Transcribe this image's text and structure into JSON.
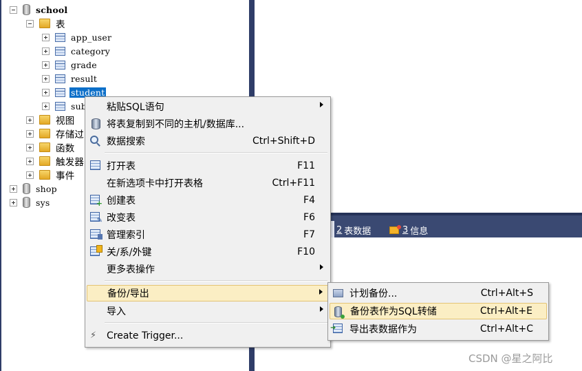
{
  "tree": {
    "items": [
      {
        "label": "school",
        "toggle": "minus",
        "icon": "database-icon",
        "style": "bold"
      },
      {
        "label": "表",
        "toggle": "minus",
        "icon": "folder-icon",
        "style": "cjk"
      },
      {
        "label": "app_user",
        "toggle": "plus",
        "icon": "table-icon",
        "style": "plain"
      },
      {
        "label": "category",
        "toggle": "plus",
        "icon": "table-icon",
        "style": "plain"
      },
      {
        "label": "grade",
        "toggle": "plus",
        "icon": "table-icon",
        "style": "plain"
      },
      {
        "label": "result",
        "toggle": "plus",
        "icon": "table-icon",
        "style": "plain"
      },
      {
        "label": "student",
        "toggle": "plus",
        "icon": "table-icon",
        "style": "selected"
      },
      {
        "label": "sub",
        "toggle": "plus",
        "icon": "table-icon",
        "style": "plain"
      },
      {
        "label": "视图",
        "toggle": "plus",
        "icon": "folder-icon",
        "style": "cjk"
      },
      {
        "label": "存储过",
        "toggle": "plus",
        "icon": "folder-icon",
        "style": "cjk"
      },
      {
        "label": "函数",
        "toggle": "plus",
        "icon": "folder-icon",
        "style": "cjk"
      },
      {
        "label": "触发器",
        "toggle": "plus",
        "icon": "folder-icon",
        "style": "cjk"
      },
      {
        "label": "事件",
        "toggle": "plus",
        "icon": "folder-icon",
        "style": "cjk"
      },
      {
        "label": "shop",
        "toggle": "plus",
        "icon": "database-icon",
        "style": "plain"
      },
      {
        "label": "sys",
        "toggle": "plus",
        "icon": "database-icon",
        "style": "plain"
      }
    ]
  },
  "result_tabs": [
    {
      "num": "2",
      "label": "表数据"
    },
    {
      "num": "3",
      "label": "信息"
    }
  ],
  "context_menu": {
    "items": [
      {
        "label": "粘贴SQL语句",
        "shortcut": "",
        "submenu": true,
        "icon": ""
      },
      {
        "label": "将表复制到不同的主机/数据库...",
        "shortcut": "",
        "submenu": false,
        "icon": "copy-database-icon"
      },
      {
        "label": "数据搜索",
        "shortcut": "Ctrl+Shift+D",
        "submenu": false,
        "icon": "search-icon"
      },
      {
        "label": "打开表",
        "shortcut": "F11",
        "submenu": false,
        "icon": "table-icon"
      },
      {
        "label": "在新选项卡中打开表格",
        "shortcut": "Ctrl+F11",
        "submenu": false,
        "icon": ""
      },
      {
        "label": "创建表",
        "shortcut": "F4",
        "submenu": false,
        "icon": "create-table-icon"
      },
      {
        "label": "改变表",
        "shortcut": "F6",
        "submenu": false,
        "icon": "alter-table-icon"
      },
      {
        "label": "管理索引",
        "shortcut": "F7",
        "submenu": false,
        "icon": "index-icon"
      },
      {
        "label": "关/系/外键",
        "shortcut": "F10",
        "submenu": false,
        "icon": "foreign-key-icon"
      },
      {
        "label": "更多表操作",
        "shortcut": "",
        "submenu": true,
        "icon": ""
      },
      {
        "label": "备份/导出",
        "shortcut": "",
        "submenu": true,
        "icon": ""
      },
      {
        "label": "导入",
        "shortcut": "",
        "submenu": true,
        "icon": ""
      },
      {
        "label": "Create Trigger...",
        "shortcut": "",
        "submenu": false,
        "icon": "trigger-icon"
      }
    ]
  },
  "submenu": {
    "items": [
      {
        "label": "计划备份...",
        "shortcut": "Ctrl+Alt+S",
        "icon": "schedule-backup-icon"
      },
      {
        "label": "备份表作为SQL转储",
        "shortcut": "Ctrl+Alt+E",
        "icon": "sql-dump-icon"
      },
      {
        "label": "导出表数据作为",
        "shortcut": "Ctrl+Alt+C",
        "icon": "export-table-icon"
      }
    ]
  },
  "watermark": "CSDN @星之阿比",
  "colors": {
    "selection": "#0c6fc9",
    "hover": "#fbeec4",
    "panel_dark": "#2f3d68"
  }
}
